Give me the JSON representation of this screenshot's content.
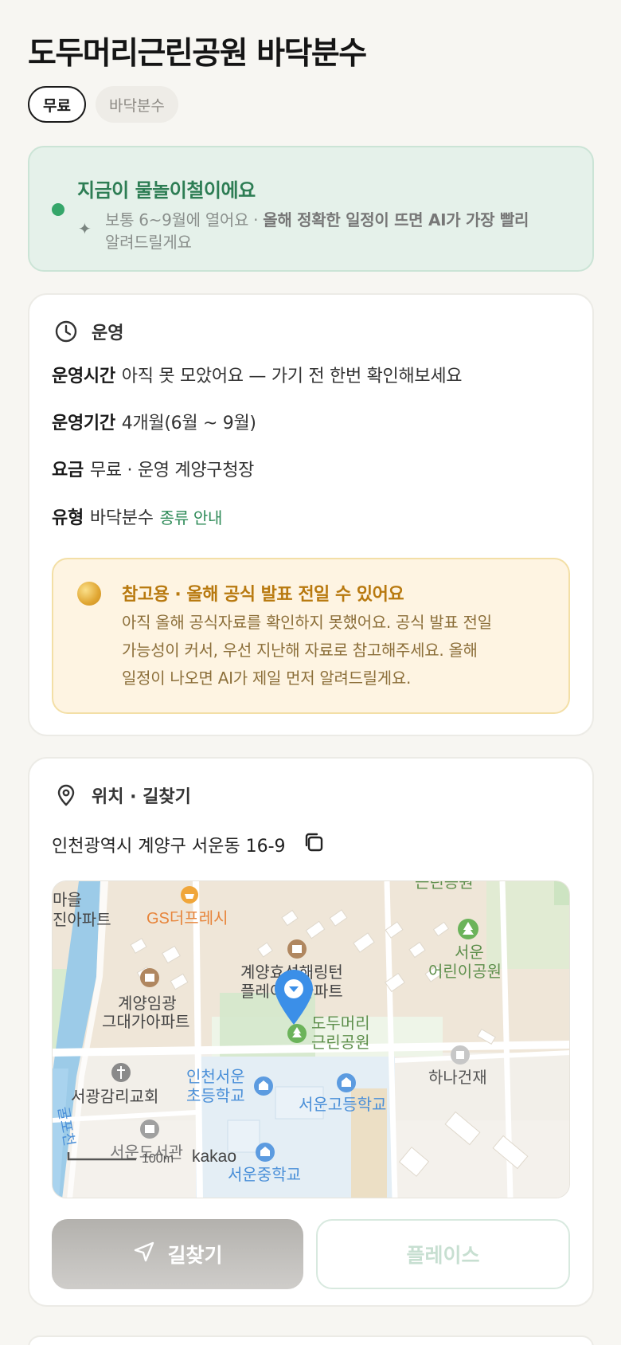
{
  "page": {
    "title": "도두머리근린공원 바닥분수"
  },
  "chips": [
    {
      "label": "무료"
    },
    {
      "label": "바닥분수"
    }
  ],
  "season": {
    "title": "지금이 물놀이철이에요",
    "text_plain": "보통 6~9월에 열어요 · ",
    "text_bold": "올해 정확한 일정이 뜨면 AI가 가장 빨리",
    "text_tail": "알려드릴게요",
    "icon": "sparkle-icon",
    "accent": "#2d7d54"
  },
  "operation": {
    "heading": "운영",
    "icon": "clock-icon",
    "rows": [
      {
        "key": "운영시간",
        "value": "아직 못 모았어요 — 가기 전 한번 확인해보세요"
      },
      {
        "key": "운영기간",
        "value": "4개월(6월 ~ 9월)"
      },
      {
        "key": "요금",
        "value": "무료 · 운영 계양구청장"
      },
      {
        "key": "유형",
        "value": "바닥분수",
        "link": "종류 안내"
      }
    ],
    "notice": {
      "title": "참고용 · 올해 공식 발표 전일 수 있어요",
      "line1": "아직 올해 공식자료를 확인하지 못했어요. 공식 발표 전일",
      "line2": "가능성이 커서, 우선 지난해 자료로 참고해주세요. 올해",
      "line3": "일정이 나오면 AI가 제일 먼저 알려드릴게요.",
      "accent": "#b8790f"
    }
  },
  "location": {
    "heading": "위치 · 길찾기",
    "icon": "location-pin-icon",
    "address": "인천광역시 계양구 서운동 16-9",
    "copy_icon": "copy-icon",
    "map": {
      "labels": {
        "apt_top_left_1": "마을",
        "apt_top_left_2": "진아파트",
        "gs": "GS더프레시",
        "geunrin_top": "근린공원",
        "seoun_park_1": "서운",
        "seoun_park_2": "어린이공원",
        "hyoseong_1": "계양효성해링턴",
        "hyoseong_2": "플레이스아파트",
        "imgwang_1": "계양임광",
        "imgwang_2": "그대가아파트",
        "dodu_1": "도두머리",
        "dodu_2": "근린공원",
        "hana": "하나건재",
        "incheon_seoun_1": "인천서운",
        "incheon_seoun_2": "초등학교",
        "seoun_high": "서운고등학교",
        "church": "서광감리교회",
        "library": "서운도서관",
        "middle": "서운중학교",
        "scale": "100m",
        "brand": "kakao",
        "river": "굴포천"
      }
    },
    "buttons": {
      "directions": "길찾기",
      "directions_icon": "navigation-arrow-icon",
      "place": "플레이스"
    }
  }
}
